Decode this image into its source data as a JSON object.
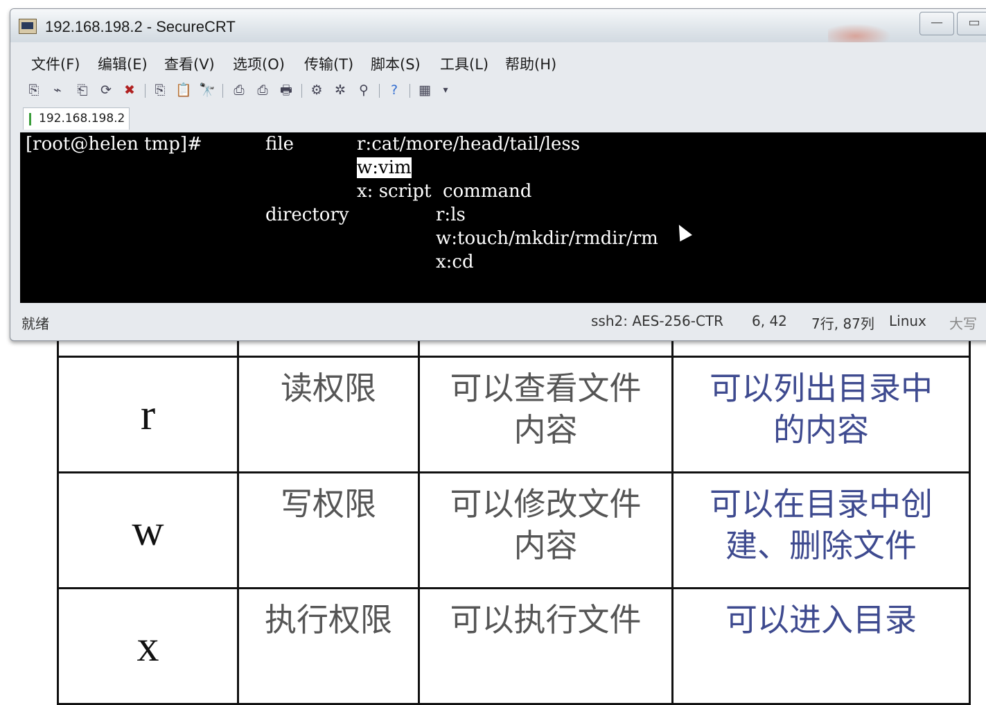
{
  "window": {
    "title": "192.168.198.2 - SecureCRT",
    "minimize_symbol": "—",
    "maximize_symbol": "▭"
  },
  "menu": [
    "文件(F)",
    "编辑(E)",
    "查看(V)",
    "选项(O)",
    "传输(T)",
    "脚本(S)",
    "工具(L)",
    "帮助(H)"
  ],
  "toolbar": {
    "icons": [
      "connect-icon",
      "quick-connect-icon",
      "connect-tab-icon",
      "reconnect-icon",
      "disconnect-icon",
      "copy-icon",
      "paste-icon",
      "find-icon",
      "print-setup-icon",
      "print-icon",
      "printer-icon",
      "session-options-icon",
      "global-options-icon",
      "keymap-icon",
      "help-icon",
      "sftp-icon",
      "more-icon"
    ],
    "glyphs": [
      "⎘",
      "⌁",
      "⎗",
      "⟳",
      "✖",
      "⎘",
      "📋",
      "🔭",
      "⎙",
      "⎙",
      "🖶",
      "⚙",
      "✲",
      "⚲",
      "?",
      "▦",
      "▾"
    ]
  },
  "tab": {
    "label": "192.168.198.2"
  },
  "terminal": {
    "prompt": "[root@helen tmp]#",
    "file_label": "file",
    "file_r": "r:cat/more/head/tail/less",
    "file_w": "w:vim",
    "file_x": "x: script  command",
    "dir_label": "directory",
    "dir_r": "r:ls",
    "dir_w": "w:touch/mkdir/rmdir/rm",
    "dir_x": "x:cd"
  },
  "status": {
    "ready": "就绪",
    "protocol": "ssh2: AES-256-CTR",
    "cursor_pos": "6, 42",
    "size": "7行, 87列",
    "terminal_type": "Linux",
    "caps": "大写"
  },
  "permissions": {
    "rows": [
      {
        "letter": "r",
        "name": "读权限",
        "file": [
          "可以查看文件",
          "内容"
        ],
        "dir": [
          "可以列出目录中",
          "的内容"
        ]
      },
      {
        "letter": "w",
        "name": "写权限",
        "file": [
          "可以修改文件",
          "内容"
        ],
        "dir": [
          "可以在目录中创",
          "建、删除文件"
        ]
      },
      {
        "letter": "x",
        "name": "执行权限",
        "file": [
          "可以执行文件"
        ],
        "dir": [
          "可以进入目录"
        ]
      }
    ]
  }
}
